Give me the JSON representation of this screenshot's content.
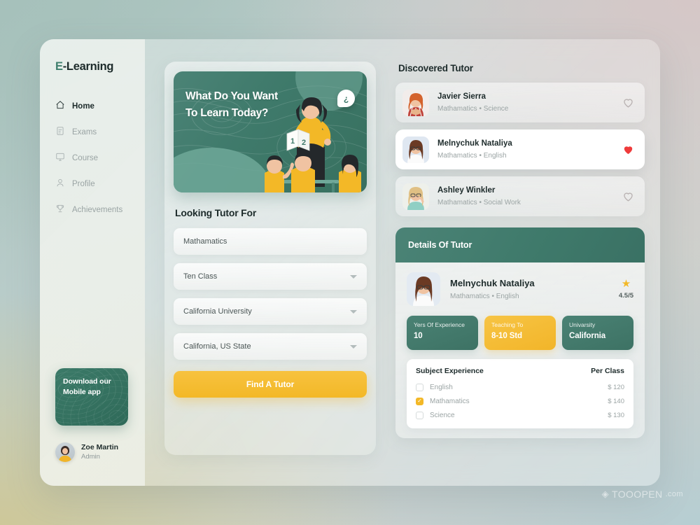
{
  "brand": {
    "prefix": "E",
    "rest": "-Learning"
  },
  "sidebar": {
    "items": [
      {
        "label": "Home",
        "icon": "home-icon",
        "active": true
      },
      {
        "label": "Exams",
        "icon": "clipboard-icon",
        "active": false
      },
      {
        "label": "Course",
        "icon": "monitor-icon",
        "active": false
      },
      {
        "label": "Profile",
        "icon": "user-icon",
        "active": false
      },
      {
        "label": "Achievements",
        "icon": "trophy-icon",
        "active": false
      }
    ],
    "promo": {
      "text": "Download our Mobile app"
    },
    "user": {
      "name": "Zoe Martin",
      "role": "Admin"
    }
  },
  "hero": {
    "line1": "What Do You Want",
    "line2": "To Learn Today?",
    "badge": "¿",
    "card_numbers": [
      "1",
      "2"
    ]
  },
  "form": {
    "title": "Looking Tutor  For",
    "fields": [
      {
        "value": "Mathamatics",
        "caret": false
      },
      {
        "value": "Ten Class",
        "caret": true
      },
      {
        "value": "California University",
        "caret": true
      },
      {
        "value": "California, US State",
        "caret": true
      }
    ],
    "cta": "Find A Tutor"
  },
  "discovered": {
    "title": "Discovered Tutor",
    "tutors": [
      {
        "name": "Javier Sierra",
        "subjects": "Mathamatics  •  Science",
        "liked": false
      },
      {
        "name": "Melnychuk Nataliya",
        "subjects": "Mathamatics  •  English",
        "liked": true
      },
      {
        "name": "Ashley Winkler",
        "subjects": "Mathamatics  •  Social Work",
        "liked": false
      }
    ]
  },
  "details": {
    "header": "Details Of Tutor",
    "name": "Melnychuk Nataliya",
    "subjects": "Mathamatics  •  English",
    "star": "★",
    "rating": "4.5/5",
    "stats": [
      {
        "label": "Yers Of Experience",
        "value": "10",
        "color": "green"
      },
      {
        "label": "Teaching To",
        "value": "8-10 Std",
        "color": "amber"
      },
      {
        "label": "Univarsity",
        "value": "California",
        "color": "green"
      }
    ],
    "table": {
      "col_subject": "Subject Experience",
      "col_price": "Per Class",
      "rows": [
        {
          "subject": "English",
          "price": "$ 120",
          "checked": false
        },
        {
          "subject": "Mathamatics",
          "price": "$ 140",
          "checked": true
        },
        {
          "subject": "Science",
          "price": "$ 130",
          "checked": false
        }
      ]
    }
  },
  "watermark": {
    "icon": "◈",
    "text": "TOOOPEN",
    "suffix": ".com"
  },
  "colors": {
    "accent_green": "#3f7a6b",
    "accent_amber": "#f3b827",
    "heart_red": "#ef3b3b",
    "text_dark": "#1d2b2b",
    "text_muted": "#9ba4a4"
  }
}
